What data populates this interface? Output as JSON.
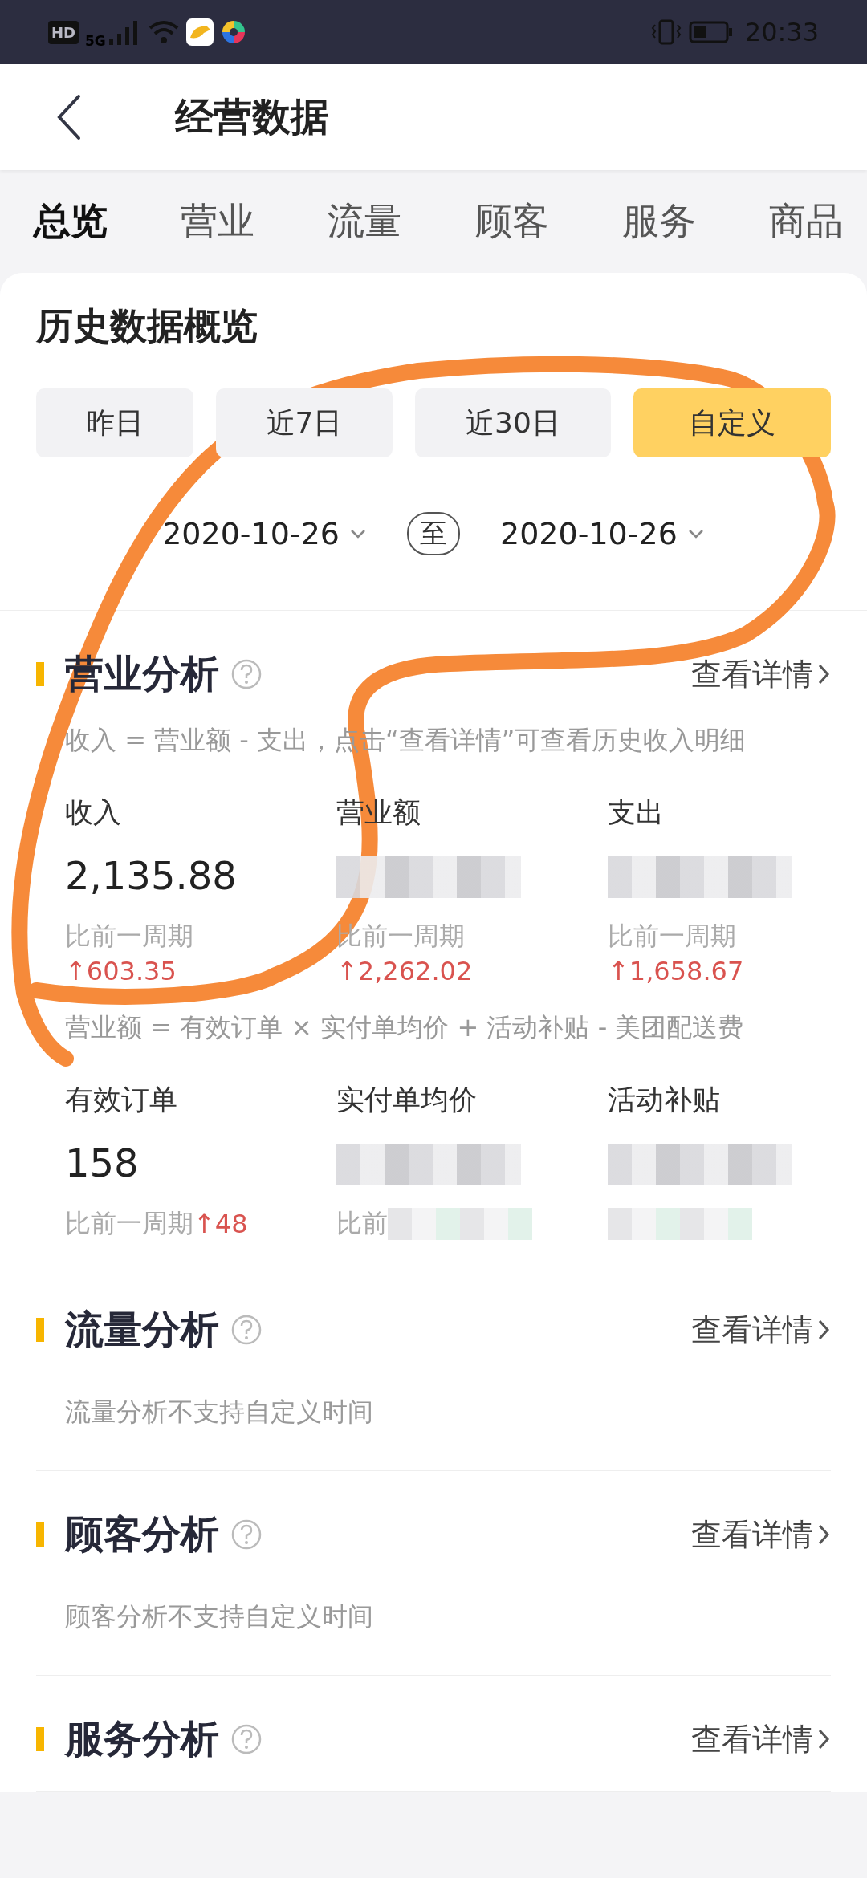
{
  "status_bar": {
    "hd_label": "HD",
    "network": "5G",
    "time": "20:33"
  },
  "header": {
    "title": "经营数据"
  },
  "tabs": [
    {
      "label": "总览",
      "selected": true
    },
    {
      "label": "营业",
      "selected": false
    },
    {
      "label": "流量",
      "selected": false
    },
    {
      "label": "顾客",
      "selected": false
    },
    {
      "label": "服务",
      "selected": false
    },
    {
      "label": "商品",
      "selected": false
    }
  ],
  "overview": {
    "title": "历史数据概览",
    "ranges": [
      {
        "label": "昨日",
        "selected": false
      },
      {
        "label": "近7日",
        "selected": false
      },
      {
        "label": "近30日",
        "selected": false
      },
      {
        "label": "自定义",
        "selected": true
      }
    ],
    "start_date": "2020-10-26",
    "separator": "至",
    "end_date": "2020-10-26"
  },
  "business": {
    "title": "营业分析",
    "link": "查看详情",
    "hint": "收入 = 营业额 - 支出，点击“查看详情”可查看历史收入明细",
    "metrics": [
      {
        "label": "收入",
        "value": "2,135.88",
        "compare": "比前一周期",
        "delta": "↑603.35",
        "value_hidden": false,
        "compare_hidden": false,
        "delta_inline": false
      },
      {
        "label": "营业额",
        "compare": "比前一周期",
        "delta": "↑2,262.02",
        "value_hidden": true,
        "compare_hidden": false,
        "delta_inline": false
      },
      {
        "label": "支出",
        "compare": "比前一周期",
        "delta": "↑1,658.67",
        "value_hidden": true,
        "compare_hidden": false,
        "delta_inline": false
      }
    ],
    "formula": "营业额 = 有效订单 × 实付单均价 + 活动补贴 - 美团配送费",
    "metrics_2": [
      {
        "label": "有效订单",
        "value": "158",
        "compare": "比前一周期",
        "delta": "↑48",
        "value_hidden": false,
        "compare_hidden": false,
        "delta_inline": true
      },
      {
        "label": "实付单均价",
        "compare": "比前",
        "value_hidden": true,
        "compare_hidden": true
      },
      {
        "label": "活动补贴",
        "value_hidden": true,
        "compare_hidden": true
      }
    ]
  },
  "sections": [
    {
      "title": "流量分析",
      "link": "查看详情",
      "note": "流量分析不支持自定义时间"
    },
    {
      "title": "顾客分析",
      "link": "查看详情",
      "note": "顾客分析不支持自定义时间"
    },
    {
      "title": "服务分析",
      "link": "查看详情"
    }
  ]
}
